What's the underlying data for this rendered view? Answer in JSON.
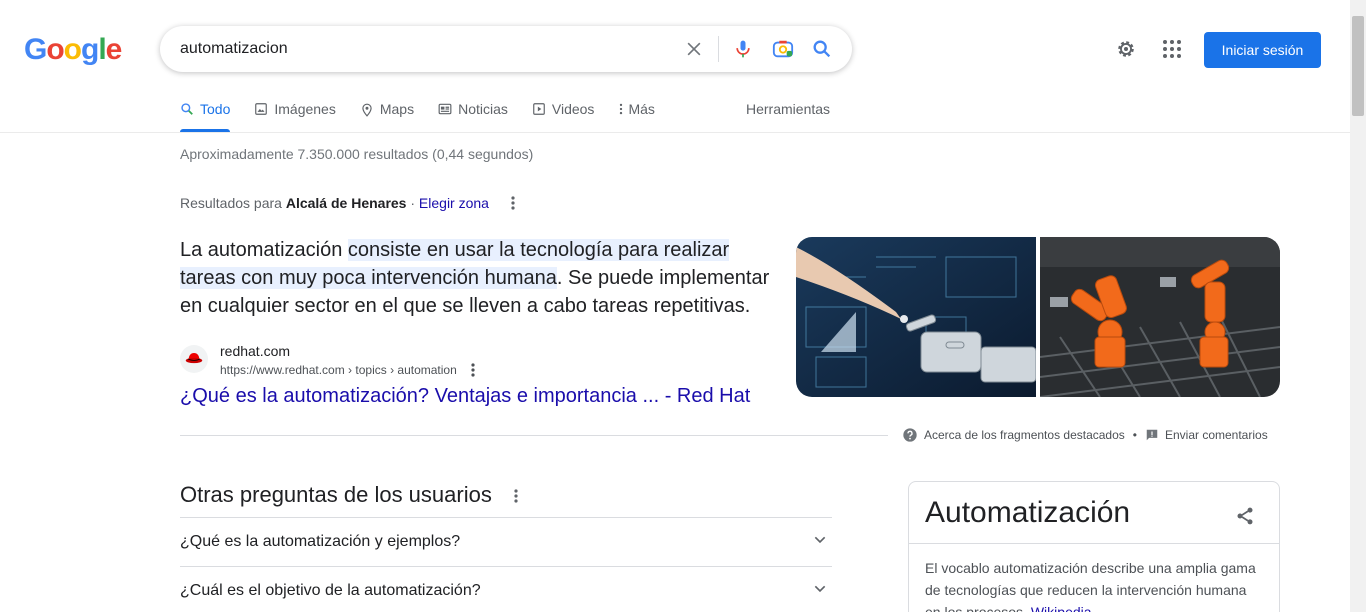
{
  "logo": {
    "letters": [
      "G",
      "o",
      "o",
      "g",
      "l",
      "e"
    ]
  },
  "search": {
    "value": "automatizacion"
  },
  "header": {
    "signin_label": "Iniciar sesión"
  },
  "tabs": [
    {
      "label": "Todo",
      "icon": "search-icon",
      "active": true
    },
    {
      "label": "Imágenes",
      "icon": "image-icon"
    },
    {
      "label": "Maps",
      "icon": "map-pin-icon"
    },
    {
      "label": "Noticias",
      "icon": "news-icon"
    },
    {
      "label": "Videos",
      "icon": "video-icon"
    },
    {
      "label": "Más",
      "icon": "more-vert-icon"
    }
  ],
  "tools_label": "Herramientas",
  "stats": "Aproximadamente 7.350.000 resultados (0,44 segundos)",
  "location": {
    "prefix": "Resultados para ",
    "place": "Alcalá de Henares",
    "separator": " · ",
    "link": "Elegir zona"
  },
  "snippet": {
    "before": "La automatización ",
    "highlight": "consiste en usar la tecnología para realizar tareas con muy poca intervención humana",
    "after": ". Se puede implementar en cualquier sector en el que se lleven a cabo tareas repetitivas."
  },
  "source": {
    "name": "redhat.com",
    "url": "https://www.redhat.com › topics › automation",
    "title": "¿Qué es la automatización? Ventajas e importancia ... - Red Hat"
  },
  "about": {
    "featured": "Acerca de los fragmentos destacados",
    "bullet": "•",
    "feedback": "Enviar comentarios"
  },
  "paa": {
    "title": "Otras preguntas de los usuarios",
    "questions": [
      "¿Qué es la automatización y ejemplos?",
      "¿Cuál es el objetivo de la automatización?"
    ]
  },
  "knowledge_panel": {
    "title": "Automatización",
    "description": "El vocablo automatización describe una amplia gama de tecnologías que reducen la intervención humana en los procesos. ",
    "source_link": "Wikipedia"
  },
  "colors": {
    "accent": "#1a73e8",
    "link": "#1a0dab",
    "highlight": "#e8f0fe"
  }
}
